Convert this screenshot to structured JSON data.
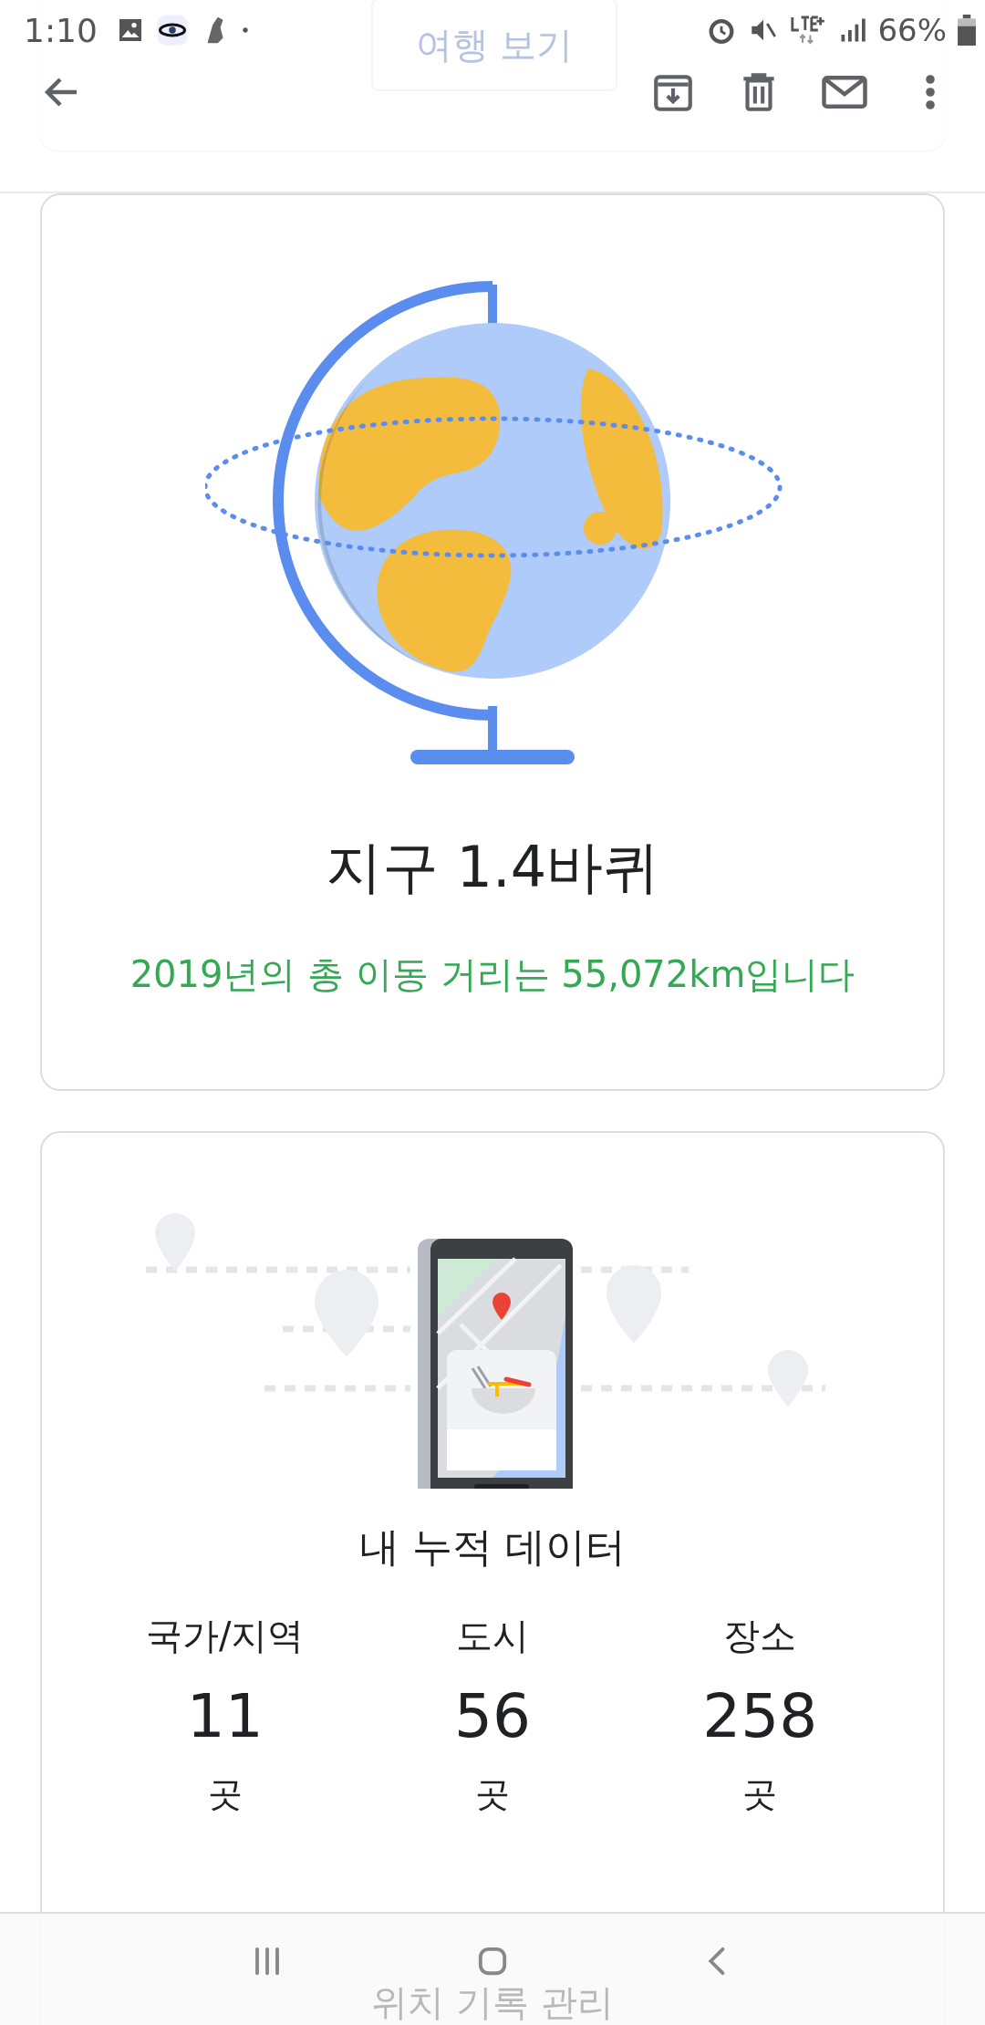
{
  "status_bar": {
    "time": "1:10",
    "battery": "66%"
  },
  "behind_top": {
    "label": "여행 보기"
  },
  "distance_card": {
    "title": "지구 1.4바퀴",
    "subtitle": "2019년의 총 이동 거리는 55,072km입니다"
  },
  "stats_card": {
    "title": "내 누적 데이터",
    "stats": [
      {
        "label": "국가/지역",
        "value": "11",
        "unit": "곳"
      },
      {
        "label": "도시",
        "value": "56",
        "unit": "곳"
      },
      {
        "label": "장소",
        "value": "258",
        "unit": "곳"
      }
    ]
  },
  "behind_bottom": {
    "label": "위치 기록 관리"
  }
}
